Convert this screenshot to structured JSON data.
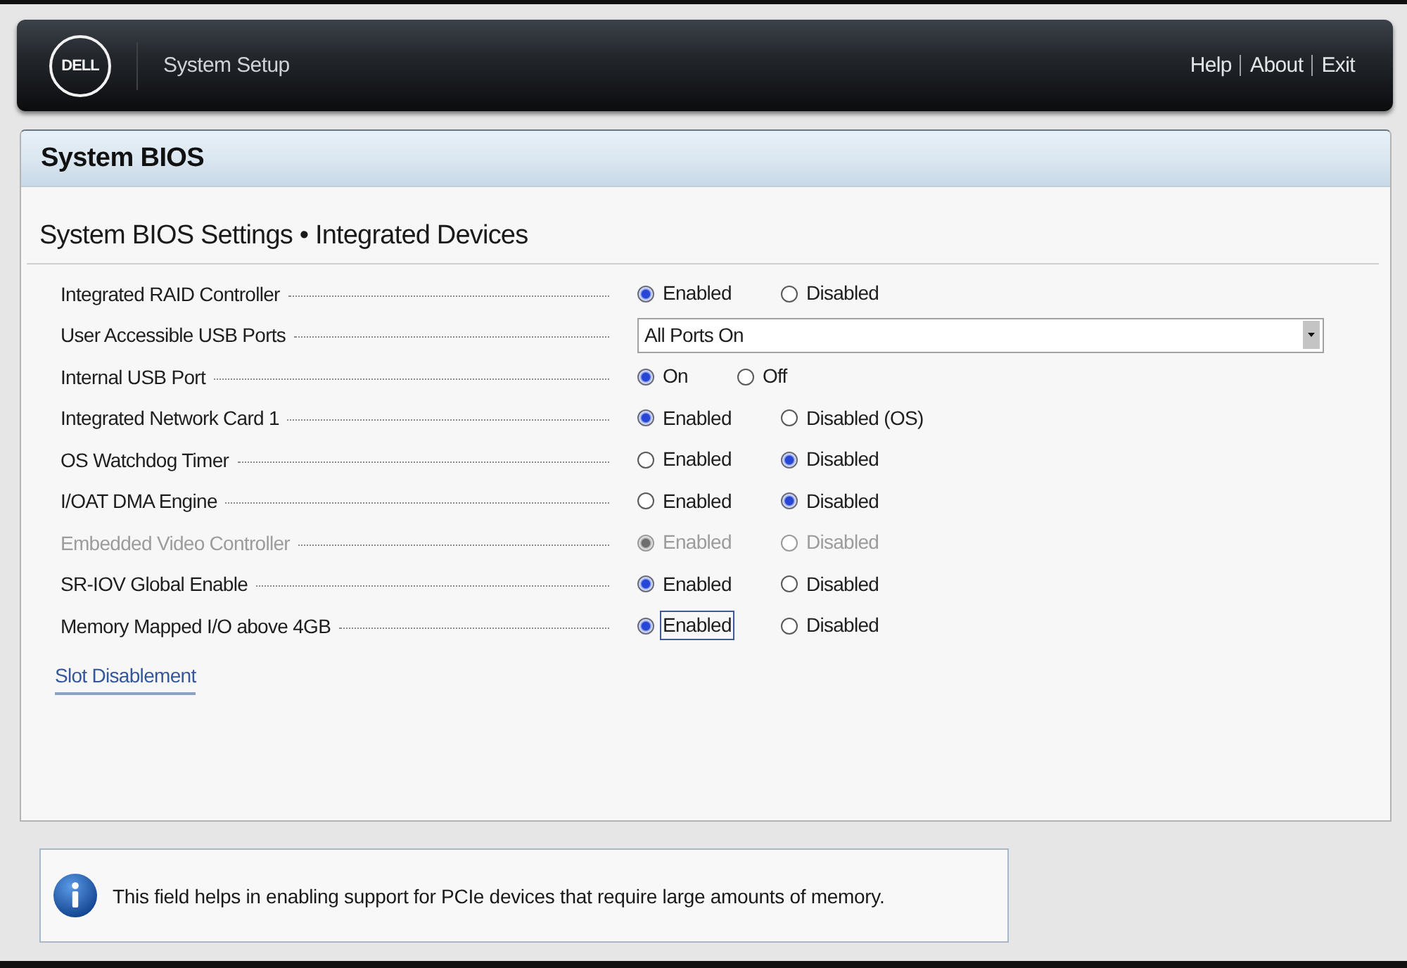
{
  "header": {
    "logo": "DELL",
    "title": "System Setup",
    "links": [
      "Help",
      "About",
      "Exit"
    ]
  },
  "panel": {
    "title": "System BIOS",
    "heading": "System BIOS Settings • Integrated Devices"
  },
  "settings": [
    {
      "kind": "radio",
      "label": "Integrated RAID Controller",
      "disabled": false,
      "options": [
        {
          "label": "Enabled",
          "selected": true,
          "focused": false
        },
        {
          "label": "Disabled",
          "selected": false,
          "focused": false
        }
      ]
    },
    {
      "kind": "dropdown",
      "label": "User Accessible USB Ports",
      "disabled": false,
      "value": "All Ports On"
    },
    {
      "kind": "radio",
      "label": "Internal USB Port",
      "disabled": false,
      "options": [
        {
          "label": "On",
          "selected": true,
          "focused": false
        },
        {
          "label": "Off",
          "selected": false,
          "focused": false
        }
      ]
    },
    {
      "kind": "radio",
      "label": "Integrated Network Card 1",
      "disabled": false,
      "options": [
        {
          "label": "Enabled",
          "selected": true,
          "focused": false
        },
        {
          "label": "Disabled (OS)",
          "selected": false,
          "focused": false
        }
      ]
    },
    {
      "kind": "radio",
      "label": "OS Watchdog Timer",
      "disabled": false,
      "options": [
        {
          "label": "Enabled",
          "selected": false,
          "focused": false
        },
        {
          "label": "Disabled",
          "selected": true,
          "focused": false
        }
      ]
    },
    {
      "kind": "radio",
      "label": "I/OAT DMA Engine",
      "disabled": false,
      "options": [
        {
          "label": "Enabled",
          "selected": false,
          "focused": false
        },
        {
          "label": "Disabled",
          "selected": true,
          "focused": false
        }
      ]
    },
    {
      "kind": "radio",
      "label": "Embedded Video Controller",
      "disabled": true,
      "options": [
        {
          "label": "Enabled",
          "selected": true,
          "focused": false
        },
        {
          "label": "Disabled",
          "selected": false,
          "focused": false
        }
      ]
    },
    {
      "kind": "radio",
      "label": "SR-IOV Global Enable",
      "disabled": false,
      "options": [
        {
          "label": "Enabled",
          "selected": true,
          "focused": false
        },
        {
          "label": "Disabled",
          "selected": false,
          "focused": false
        }
      ]
    },
    {
      "kind": "radio",
      "label": "Memory Mapped I/O above 4GB",
      "disabled": false,
      "options": [
        {
          "label": "Enabled",
          "selected": true,
          "focused": true
        },
        {
          "label": "Disabled",
          "selected": false,
          "focused": false
        }
      ]
    }
  ],
  "link": "Slot Disablement",
  "help": "This field helps in enabling support for PCIe devices that require large amounts of memory."
}
